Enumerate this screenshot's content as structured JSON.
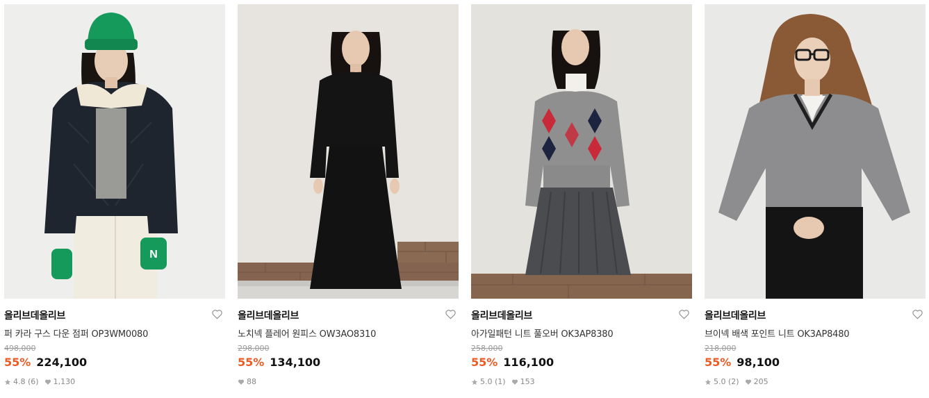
{
  "colors": {
    "discount": "#ee5a24",
    "brand_text": "#111111",
    "muted": "#888888"
  },
  "icons": {
    "wishlist": "heart-outline-icon",
    "rating": "star-icon",
    "likes": "heart-filled-icon"
  },
  "products": [
    {
      "brand": "올리브데올리브",
      "name": "퍼 카라 구스 다운 점퍼 OP3WM0080",
      "original_price": "498,000",
      "discount": "55%",
      "price": "224,100",
      "rating": "4.8 (6)",
      "likes": "1,130",
      "image": "model-black-down-jacket-green-beanie"
    },
    {
      "brand": "올리브데올리브",
      "name": "노치넥 플레어 원피스 OW3AO8310",
      "original_price": "298,000",
      "discount": "55%",
      "price": "134,100",
      "rating": "",
      "likes": "88",
      "image": "model-black-notch-collar-dress"
    },
    {
      "brand": "올리브데올리브",
      "name": "아가일패턴 니트 풀오버 OK3AP8380",
      "original_price": "258,000",
      "discount": "55%",
      "price": "116,100",
      "rating": "5.0 (1)",
      "likes": "153",
      "image": "model-grey-argyle-knit-pleated-skirt"
    },
    {
      "brand": "올리브데올리브",
      "name": "브이넥 배색 포인트 니트 OK3AP8480",
      "original_price": "218,000",
      "discount": "55%",
      "price": "98,100",
      "rating": "5.0 (2)",
      "likes": "205",
      "image": "model-grey-vneck-knit-glasses"
    }
  ]
}
